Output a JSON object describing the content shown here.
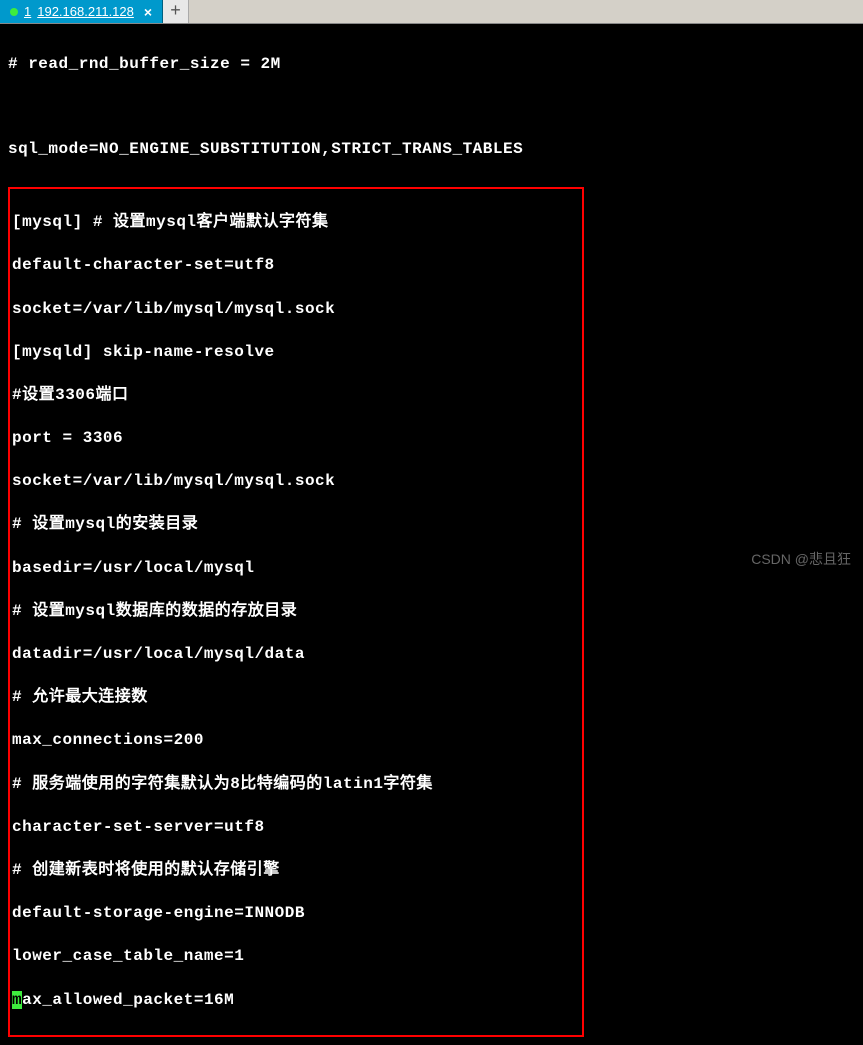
{
  "tab": {
    "number": "1",
    "title": "192.168.211.128",
    "close": "×",
    "new_tab": "+"
  },
  "terminal": {
    "line1": "# read_rnd_buffer_size = 2M",
    "line2": "",
    "line3": "sql_mode=NO_ENGINE_SUBSTITUTION,STRICT_TRANS_TABLES",
    "box": {
      "l1": "[mysql] # 设置mysql客户端默认字符集",
      "l2": "default-character-set=utf8",
      "l3": "socket=/var/lib/mysql/mysql.sock",
      "l4": "[mysqld] skip-name-resolve",
      "l5": "#设置3306端口",
      "l6": "port = 3306",
      "l7": "socket=/var/lib/mysql/mysql.sock",
      "l8": "# 设置mysql的安装目录",
      "l9": "basedir=/usr/local/mysql",
      "l10": "# 设置mysql数据库的数据的存放目录",
      "l11": "datadir=/usr/local/mysql/data",
      "l12": "# 允许最大连接数",
      "l13": "max_connections=200",
      "l14": "# 服务端使用的字符集默认为8比特编码的latin1字符集",
      "l15": "character-set-server=utf8",
      "l16": "# 创建新表时将使用的默认存储引擎",
      "l17": "default-storage-engine=INNODB",
      "l18": "lower_case_table_name=1",
      "cursor_char": "m",
      "l19_rest": "ax_allowed_packet=16M"
    }
  },
  "watermark": "CSDN @悲且狂"
}
